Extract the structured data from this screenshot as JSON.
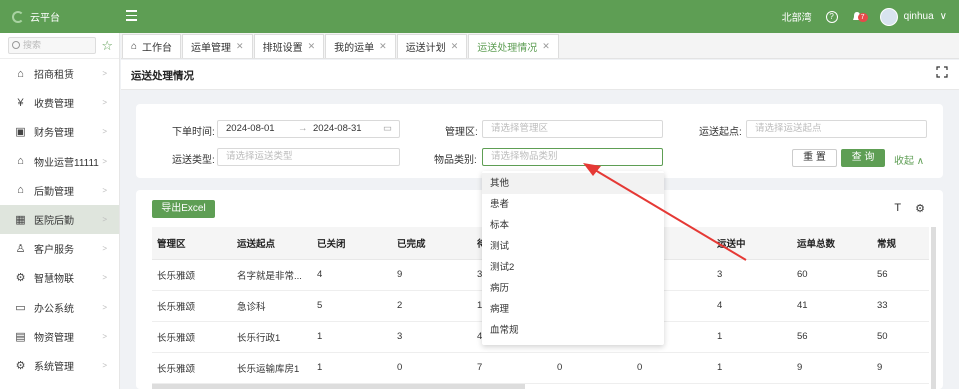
{
  "app": {
    "name": "云平台",
    "location": "北部湾",
    "notif_count": "7",
    "username": "qinhua"
  },
  "sidebar": {
    "search_placeholder": "搜索",
    "items": [
      {
        "label": "招商租赁",
        "icon": "house-icon"
      },
      {
        "label": "收费管理",
        "icon": "money-bag-icon"
      },
      {
        "label": "财务管理",
        "icon": "ledger-icon"
      },
      {
        "label": "物业运营11111",
        "icon": "building-icon"
      },
      {
        "label": "后勤管理",
        "icon": "home-gear-icon"
      },
      {
        "label": "医院后勤",
        "icon": "hospital-icon"
      },
      {
        "label": "客户服务",
        "icon": "person-icon"
      },
      {
        "label": "智慧物联",
        "icon": "iot-icon"
      },
      {
        "label": "办公系统",
        "icon": "briefcase-icon"
      },
      {
        "label": "物资管理",
        "icon": "box-icon"
      },
      {
        "label": "系统管理",
        "icon": "gear-icon"
      }
    ]
  },
  "tabs": [
    {
      "label": "工作台"
    },
    {
      "label": "运单管理"
    },
    {
      "label": "排班设置"
    },
    {
      "label": "我的运单"
    },
    {
      "label": "运送计划"
    },
    {
      "label": "运送处理情况"
    }
  ],
  "page": {
    "title": "运送处理情况"
  },
  "filter": {
    "order_time_label": "下单时间:",
    "date_start": "2024-08-01",
    "date_sep": "→",
    "date_end": "2024-08-31",
    "region_label": "管理区:",
    "region_placeholder": "请选择管理区",
    "origin_label": "运送起点:",
    "origin_placeholder": "请选择运送起点",
    "type_label": "运送类型:",
    "type_placeholder": "请选择运送类型",
    "category_label": "物品类别:",
    "category_placeholder": "请选择物品类别",
    "reset": "重 置",
    "query": "查 询",
    "collapse": "收起 ∧"
  },
  "toolbar": {
    "export": "导出Excel"
  },
  "table": {
    "headers": [
      "管理区",
      "运送起点",
      "已关闭",
      "已完成",
      "待",
      "",
      "",
      "运送中",
      "运单总数",
      "常规"
    ],
    "rows": [
      [
        "长乐雅颂",
        "名字就是非常...",
        "4",
        "9",
        "3",
        "",
        "",
        "3",
        "60",
        "56"
      ],
      [
        "长乐雅颂",
        "急诊科",
        "5",
        "2",
        "1",
        "",
        "",
        "4",
        "41",
        "33"
      ],
      [
        "长乐雅颂",
        "长乐行政1",
        "1",
        "3",
        "4",
        "",
        "",
        "1",
        "56",
        "50"
      ],
      [
        "长乐雅颂",
        "长乐运输库房1",
        "1",
        "0",
        "7",
        "0",
        "0",
        "1",
        "9",
        "9"
      ]
    ]
  },
  "dropdown": {
    "options": [
      "其他",
      "患者",
      "标本",
      "测试",
      "测试2",
      "病历",
      "病理",
      "血常规"
    ]
  },
  "colors": {
    "brand": "#5e9e54",
    "arrow": "#e53935"
  }
}
